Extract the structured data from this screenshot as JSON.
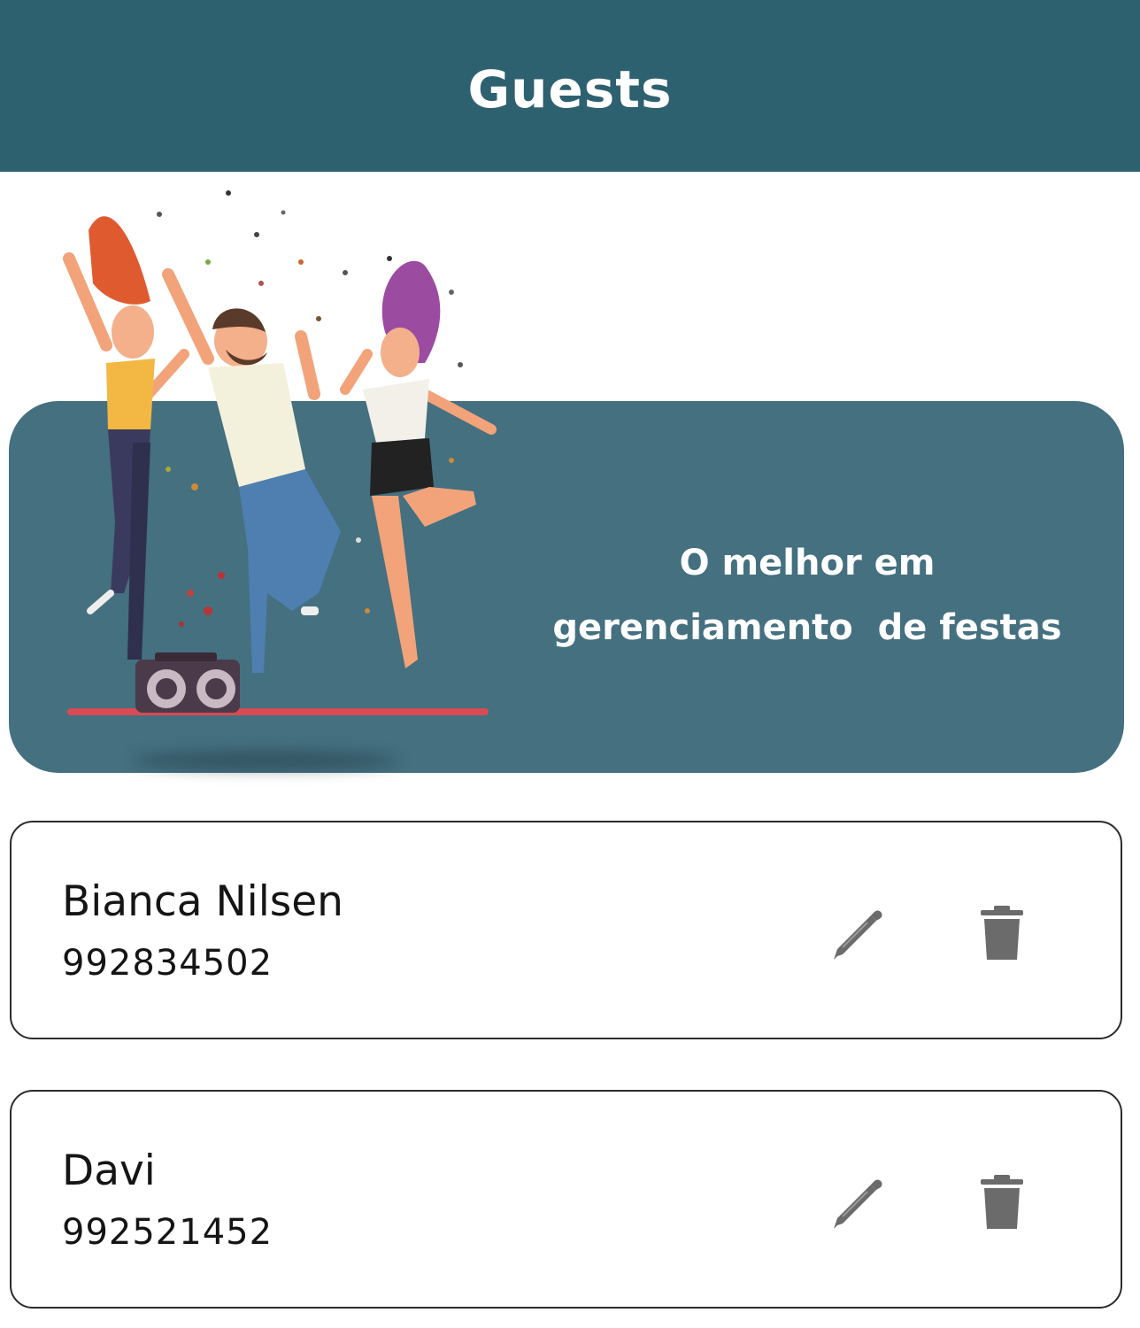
{
  "appbar": {
    "title": "Guests"
  },
  "banner": {
    "line1": "O melhor em",
    "line2": "gerenciamento  de festas",
    "illustration_icon": "dancing-people-illustration"
  },
  "guests": [
    {
      "name": "Bianca Nilsen",
      "phone": "992834502",
      "edit_icon": "pencil-icon",
      "delete_icon": "trash-icon"
    },
    {
      "name": "Davi",
      "phone": "992521452",
      "edit_icon": "pencil-icon",
      "delete_icon": "trash-icon"
    }
  ],
  "colors": {
    "appbar": "#2e6170",
    "banner": "#447080",
    "icon": "#6b6b6b",
    "card_border": "#2b2b2b"
  }
}
